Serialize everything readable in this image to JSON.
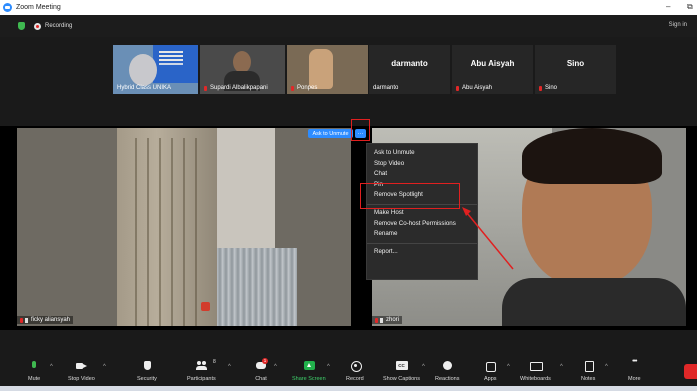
{
  "window": {
    "title": "Zoom Meeting",
    "min_glyph": "–",
    "restore_glyph": "⧉"
  },
  "status": {
    "recording_label": "Recording",
    "sign_in": "Sign in"
  },
  "thumbnails": [
    {
      "name": "Hybrid Class UNIKA"
    },
    {
      "name": "Supardi Albalikpapani"
    },
    {
      "name": "Ponpes"
    },
    {
      "display": "darmanto",
      "name": "darmanto"
    },
    {
      "display": "Abu Aisyah",
      "name": "Abu Aisyah"
    },
    {
      "display": "Sino",
      "name": "Sino"
    }
  ],
  "spotlight": {
    "left_name": "ficky aliansyah",
    "right_name": "zhori",
    "ask_button": "Ask to Unmute",
    "more_button": "···"
  },
  "context_menu": {
    "items": [
      "Ask to Unmute",
      "Stop Video",
      "Chat",
      "Pin",
      "Remove Spotlight",
      "Make Host",
      "Remove Co-host Permissions",
      "Rename",
      "Report..."
    ]
  },
  "toolbar": {
    "mute": "Mute",
    "stop_video": "Stop Video",
    "security": "Security",
    "participants": "Participants",
    "participants_count": "8",
    "chat": "Chat",
    "chat_badge": "1",
    "share_screen": "Share Screen",
    "record": "Record",
    "show_captions": "Show Captions",
    "reactions": "Reactions",
    "apps": "Apps",
    "whiteboards": "Whiteboards",
    "notes": "Notes",
    "more": "More"
  },
  "colors": {
    "accent": "#2d8cff",
    "highlight": "#e02020",
    "share": "#22b14c",
    "mic_on": "#3fb950",
    "muted": "#e02828"
  }
}
